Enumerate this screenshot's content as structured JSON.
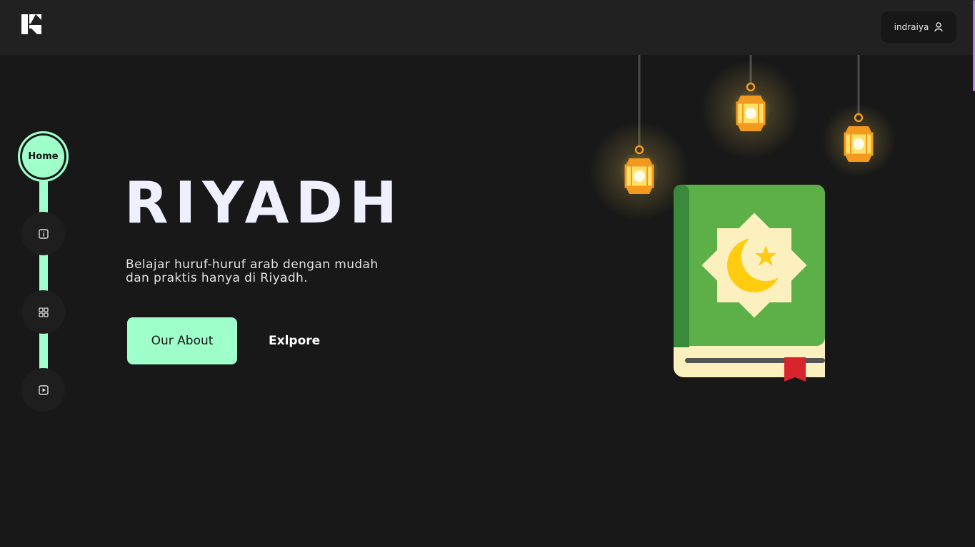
{
  "header": {
    "logo_icon": "brand-logo-icon",
    "user": {
      "name": "indraiya",
      "icon": "user-icon"
    }
  },
  "sidebar": {
    "items": [
      {
        "label": "Home",
        "active": true
      },
      {
        "label": "",
        "icon": "info-icon"
      },
      {
        "label": "",
        "icon": "grid-icon"
      },
      {
        "label": "",
        "icon": "play-icon"
      }
    ]
  },
  "hero": {
    "title": "RIYADH",
    "subtitle": "Belajar huruf-huruf arab dengan mudah dan praktis hanya di Riyadh.",
    "primary_button": "Our About",
    "secondary_button": "Exlpore"
  },
  "colors": {
    "background": "#181818",
    "header": "#212121",
    "accent": "#9effcb",
    "title": "#eef0ff"
  }
}
